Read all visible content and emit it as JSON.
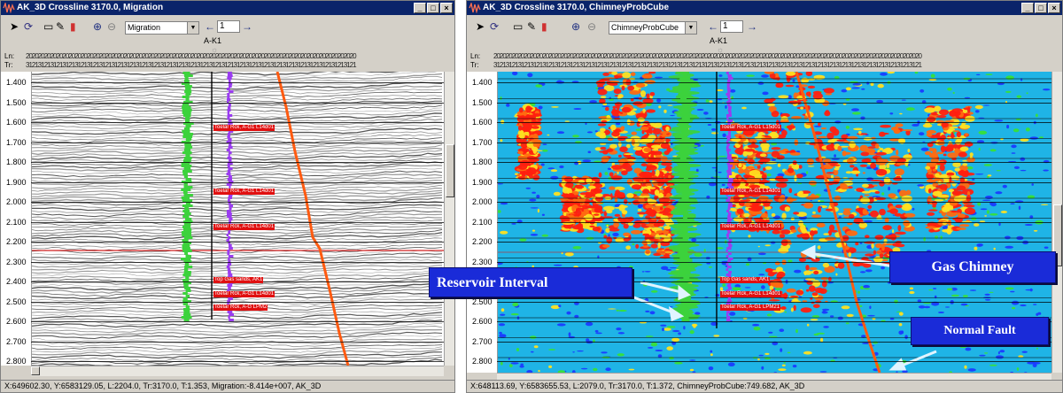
{
  "left_window": {
    "title": "AK_3D Crossline 3170.0, Migration",
    "toolbar": {
      "attribute_select": "Migration",
      "spin_value": "1"
    },
    "well_name": "A-K1",
    "axis": {
      "ln_label": "Ln:",
      "tr_label": "Tr:"
    },
    "time_labels": [
      "1.400",
      "1.500",
      "1.600",
      "1.700",
      "1.800",
      "1.900",
      "2.000",
      "2.100",
      "2.200",
      "2.300",
      "2.400",
      "2.500",
      "2.600",
      "2.700",
      "2.800"
    ],
    "markers": [
      "Toelar Rck, A-G1 L14d01",
      "Toelar Rck, A-G1 L14d01",
      "Toelar Rck, A-G1 L14d01",
      "Top Gas sands, AK1",
      "Toelar Rck, A-G1 L14d01",
      "Toelar Rck, A-G LPM2"
    ],
    "status": "X:649602.30, Y:6583129.05, L:2204.0, Tr:3170.0, T:1.353, Migration:-8.414e+007, AK_3D"
  },
  "right_window": {
    "title": "AK_3D Crossline 3170.0, ChimneyProbCube",
    "toolbar": {
      "attribute_select": "ChimneyProbCube",
      "spin_value": "1"
    },
    "well_name": "A-K1",
    "axis": {
      "ln_label": "Ln:",
      "tr_label": "Tr:"
    },
    "time_labels": [
      "1.400",
      "1.500",
      "1.600",
      "1.700",
      "1.800",
      "1.900",
      "2.000",
      "2.100",
      "2.200",
      "2.300",
      "2.400",
      "2.500",
      "2.600",
      "2.700",
      "2.800"
    ],
    "markers": [
      "Toelar Rck, A-G1 L15d01",
      "Toelar Rck, A-G1 L14d01",
      "Toelar Rck, A-G1 L14d01",
      "Top Gas sands, AK1",
      "Toelar Rck, A-G1 L14d01",
      "Toelar Rck, A-G1 LPM21"
    ],
    "status": "X:648113.69, Y:6583655.53, L:2079.0, Tr:3170.0, T:1.372, ChimneyProbCube:749.682, AK_3D"
  },
  "callouts": {
    "reservoir": "Reservoir Interval",
    "gas_chimney": "Gas Chimney",
    "normal_fault": "Normal Fault"
  },
  "colors": {
    "titlebar": "#0a246a",
    "callout_fill": "#1a2bd8",
    "chimney_bg": "#1fb4e6",
    "high_prob": "#ff2010",
    "mid_prob": "#ffe020",
    "well_green": "#3cd23c",
    "well_purple": "#9a3cf0",
    "fault": "#ff5a10"
  },
  "icons": [
    "pointer-icon",
    "rotate-icon",
    "ruler-icon",
    "edit-icon",
    "color-bar-icon",
    "zoom-in-icon",
    "zoom-out-icon",
    "arrow-left-icon",
    "arrow-right-icon",
    "sun-icon"
  ]
}
